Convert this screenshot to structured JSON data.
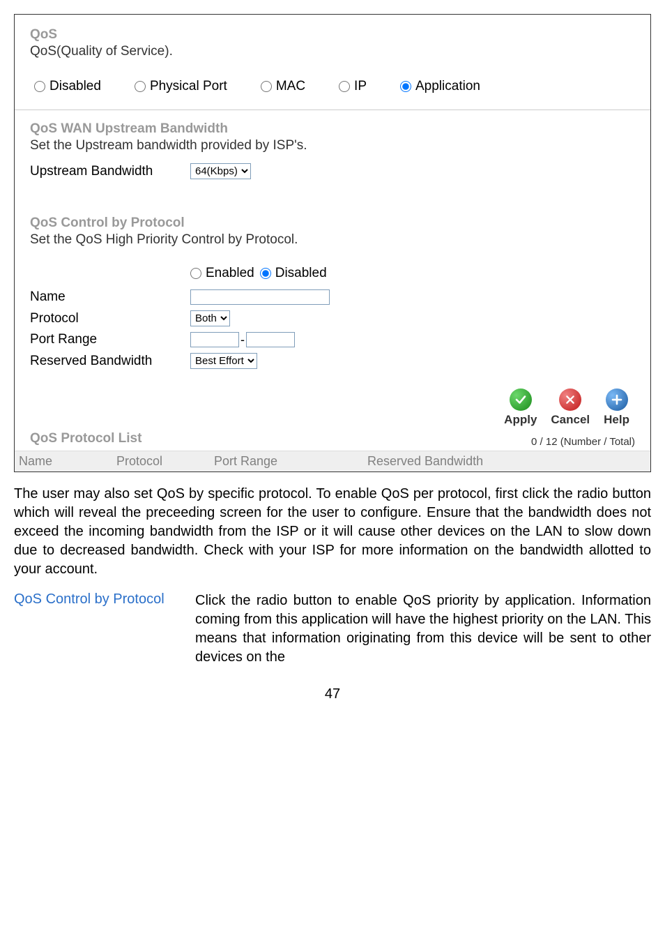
{
  "qos": {
    "title": "QoS",
    "subtitle": "QoS(Quality of Service).",
    "modes": [
      "Disabled",
      "Physical Port",
      "MAC",
      "IP",
      "Application"
    ],
    "selectedMode": "Application"
  },
  "upstream": {
    "title": "QoS WAN Upstream Bandwidth",
    "subtitle": "Set the Upstream bandwidth provided by ISP's.",
    "label": "Upstream Bandwidth",
    "value": "64(Kbps)"
  },
  "protocolControl": {
    "title": "QoS Control by Protocol",
    "subtitle": "Set the QoS High Priority Control by Protocol.",
    "enabledLabel": "Enabled",
    "disabledLabel": "Disabled",
    "fields": {
      "nameLabel": "Name",
      "nameValue": "",
      "protocolLabel": "Protocol",
      "protocolValue": "Both",
      "portRangeLabel": "Port Range",
      "portFrom": "",
      "portTo": "",
      "reservedBwLabel": "Reserved Bandwidth",
      "reservedBwValue": "Best Effort"
    }
  },
  "actions": {
    "apply": "Apply",
    "cancel": "Cancel",
    "help": "Help"
  },
  "protocolList": {
    "title": "QoS Protocol List",
    "count": "0 / 12 (Number / Total)",
    "columns": {
      "name": "Name",
      "protocol": "Protocol",
      "portRange": "Port Range",
      "reservedBw": "Reserved Bandwidth"
    }
  },
  "belowText": "The user may also set QoS by specific protocol. To enable QoS per protocol, first click the                   radio button which will reveal the preceeding screen for the user to configure. Ensure that the bandwidth does not exceed the incoming bandwidth from the ISP or it will cause other devices on the LAN to slow down due to decreased bandwidth. Check with your ISP for more information on the bandwidth allotted to your account.",
  "definition": {
    "label": "QoS Control by Protocol",
    "text": "Click  the                  radio  button  to  enable  QoS  priority  by application. Information coming from this application will have the highest priority on the LAN. This means that information originating from this device will be sent to other devices on the"
  },
  "pageNumber": "47"
}
